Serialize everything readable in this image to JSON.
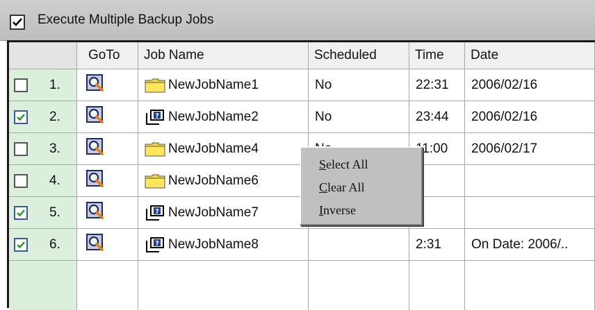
{
  "header": {
    "checkbox_checked": true,
    "title": "Execute Multiple Backup Jobs"
  },
  "table": {
    "columns": [
      "",
      "GoTo",
      "Job Name",
      "Scheduled",
      "Time",
      "Date"
    ],
    "rows": [
      {
        "checked": false,
        "num": "1.",
        "icon": "folder-icon",
        "job": "NewJobName1",
        "scheduled": "No",
        "time": "22:31",
        "date": "2006/02/16"
      },
      {
        "checked": true,
        "num": "2.",
        "icon": "unknown-type-icon",
        "job": "NewJobName2",
        "scheduled": "No",
        "time": "23:44",
        "date": "2006/02/16"
      },
      {
        "checked": false,
        "num": "3.",
        "icon": "folder-icon",
        "job": "NewJobName4",
        "scheduled": "No",
        "time": "11:00",
        "date": "2006/02/17"
      },
      {
        "checked": false,
        "num": "4.",
        "icon": "folder-icon",
        "job": "NewJobName6",
        "scheduled": "",
        "time": "",
        "date": ""
      },
      {
        "checked": true,
        "num": "5.",
        "icon": "unknown-type-icon",
        "job": "NewJobName7",
        "scheduled": "",
        "time": "",
        "date": ""
      },
      {
        "checked": true,
        "num": "6.",
        "icon": "unknown-type-icon",
        "job": "NewJobName8",
        "scheduled": "",
        "time": "2:31",
        "date": "On Date: 2006/.."
      }
    ]
  },
  "context_menu": {
    "items": [
      {
        "first": "S",
        "rest": "elect All"
      },
      {
        "first": "C",
        "rest": "lear All"
      },
      {
        "first": "I",
        "rest": "nverse"
      }
    ]
  },
  "colors": {
    "selection_column": "#dcefdc",
    "header_bar": "#c4c4c4",
    "menu_face": "#c0c0c0",
    "folder_yellow": "#f7d83a"
  }
}
